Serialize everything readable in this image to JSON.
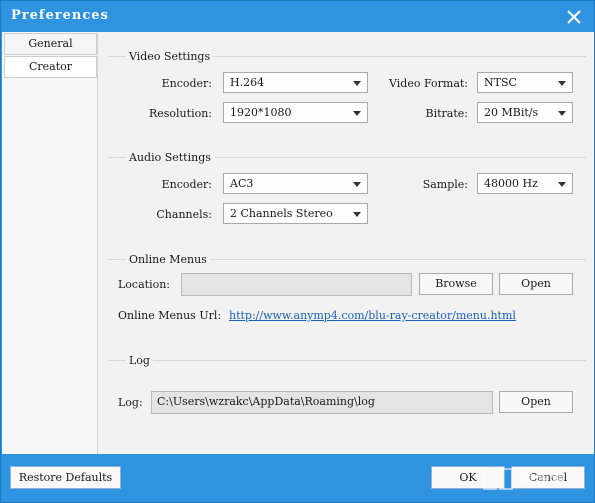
{
  "window": {
    "title": "Preferences"
  },
  "sidebar": {
    "items": [
      {
        "label": "General",
        "active": false
      },
      {
        "label": "Creator",
        "active": true
      }
    ]
  },
  "video": {
    "section_title": "Video Settings",
    "encoder_label": "Encoder:",
    "encoder_value": "H.264",
    "video_format_label": "Video Format:",
    "video_format_value": "NTSC",
    "resolution_label": "Resolution:",
    "resolution_value": "1920*1080",
    "bitrate_label": "Bitrate:",
    "bitrate_value": "20 MBit/s"
  },
  "audio": {
    "section_title": "Audio Settings",
    "encoder_label": "Encoder:",
    "encoder_value": "AC3",
    "sample_label": "Sample:",
    "sample_value": "48000 Hz",
    "channels_label": "Channels:",
    "channels_value": "2 Channels Stereo"
  },
  "online_menus": {
    "section_title": "Online Menus",
    "location_label": "Location:",
    "location_value": "",
    "browse_label": "Browse",
    "open_label": "Open",
    "url_label": "Online Menus Url:",
    "url_value": "http://www.anymp4.com/blu-ray-creator/menu.html"
  },
  "log": {
    "section_title": "Log",
    "log_label": "Log:",
    "log_value": "C:\\Users\\wzrakc\\AppData\\Roaming\\log",
    "open_label": "Open"
  },
  "footer": {
    "restore_label": "Restore Defaults",
    "ok_label": "OK",
    "cancel_label": "Cancel"
  },
  "watermark": {
    "text": "当游网"
  },
  "icons": {
    "close": "close-icon",
    "dropdown": "chevron-down-icon"
  },
  "colors": {
    "title_bar": "#2e93e0",
    "link": "#1a62b8",
    "panel": "#f2f2f2"
  }
}
